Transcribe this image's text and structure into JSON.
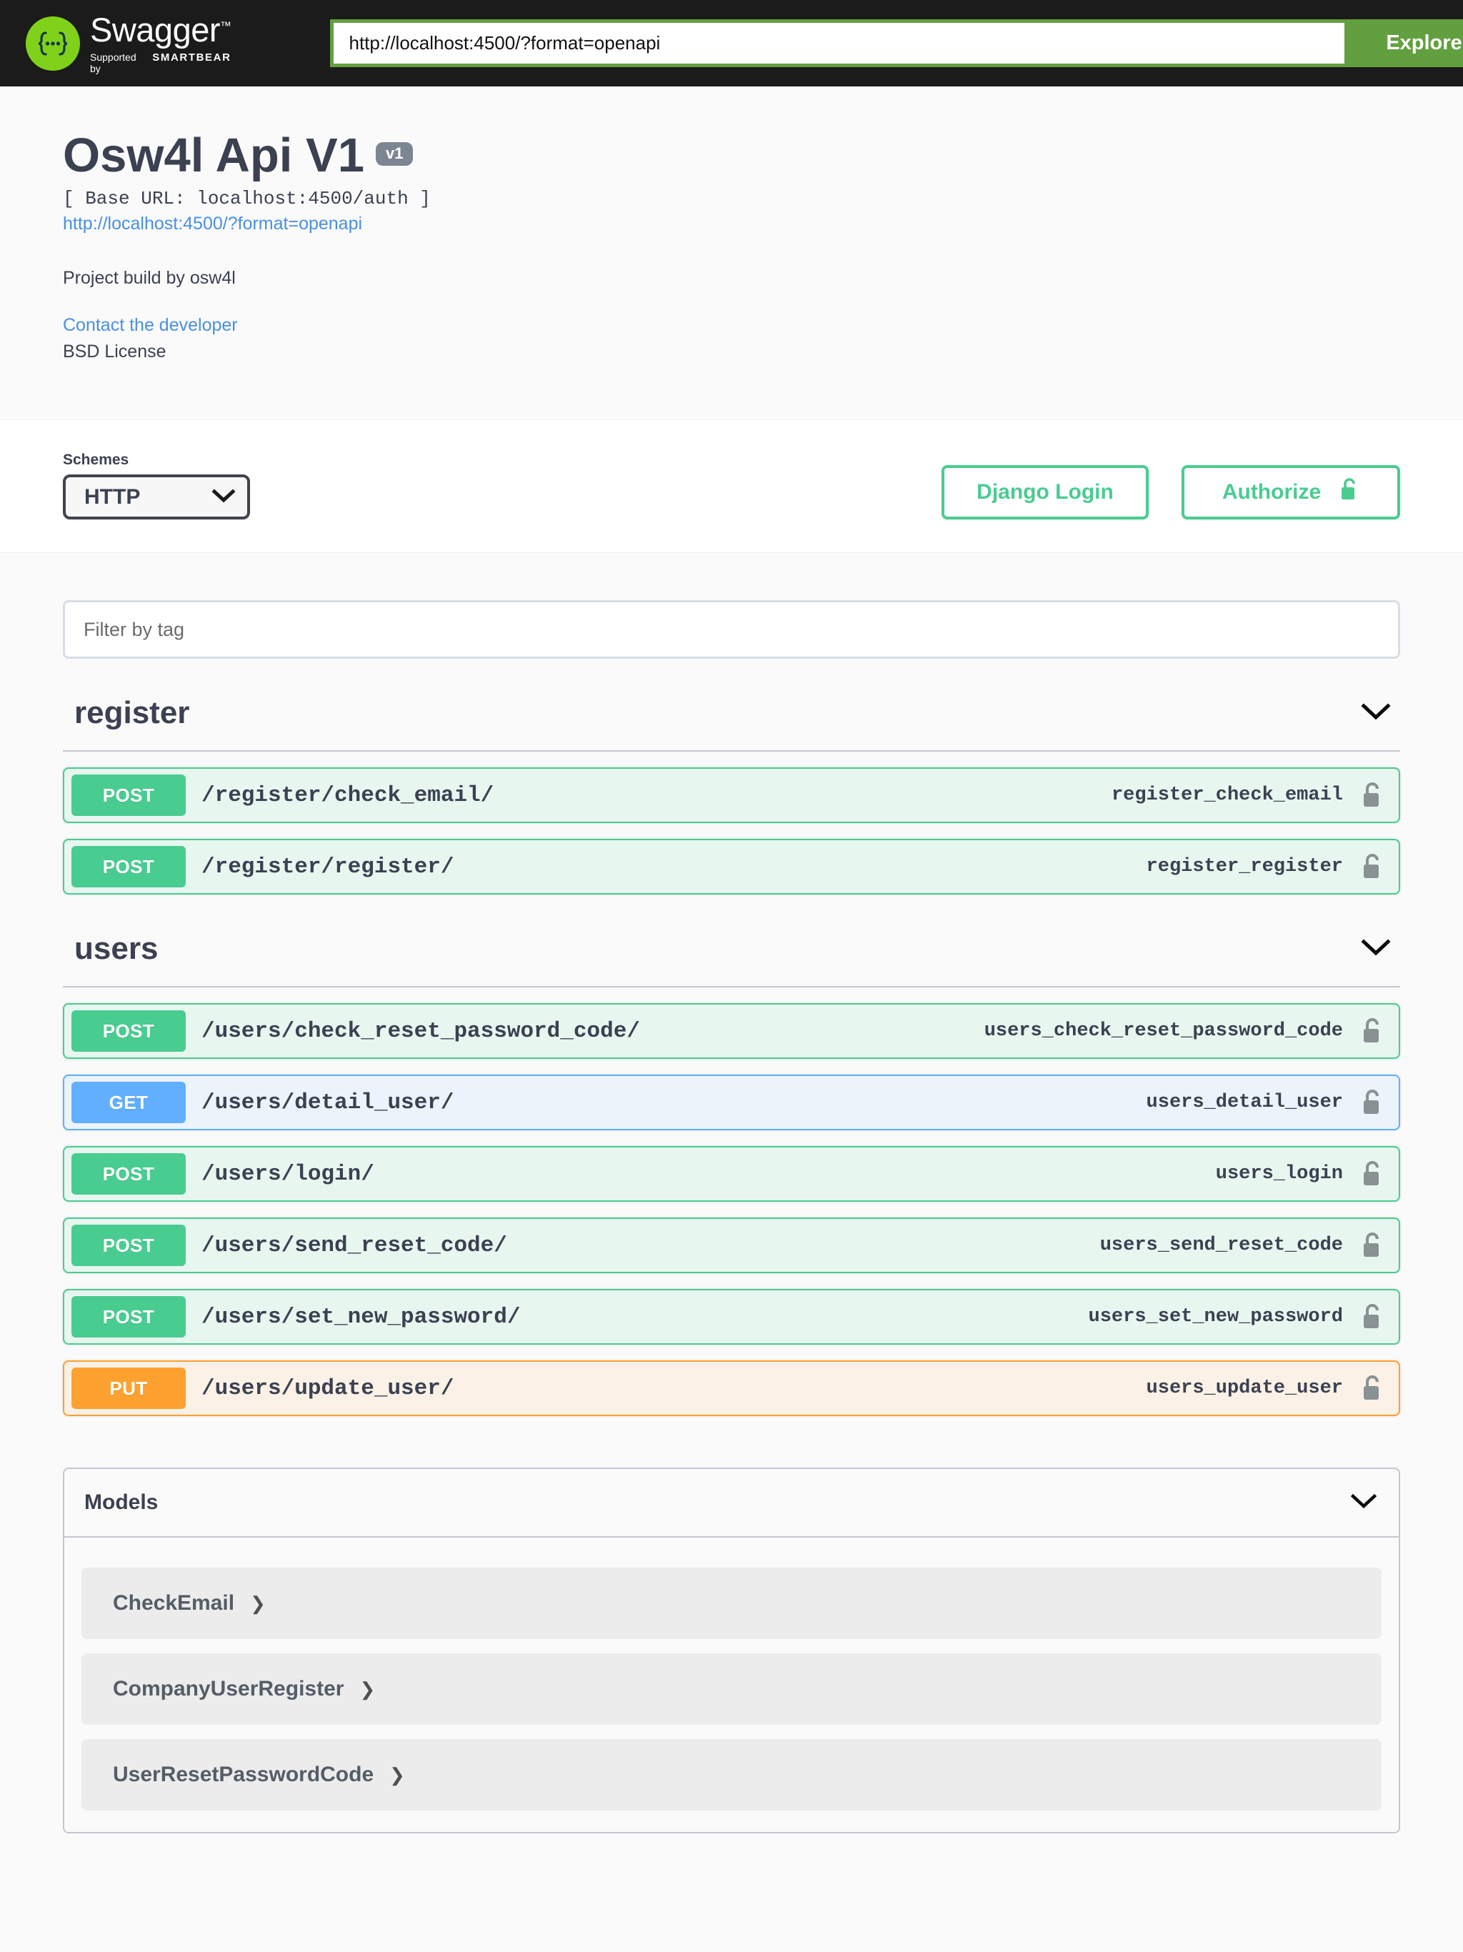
{
  "topbar": {
    "logo_title": "Swagger",
    "logo_tm": "™",
    "logo_supported_prefix": "Supported by",
    "logo_brand": "SMARTBEAR",
    "url_value": "http://localhost:4500/?format=openapi",
    "url_placeholder": "http://localhost:4500/?format=openapi",
    "explore_label": "Explore"
  },
  "info": {
    "title": "Osw4l Api V1",
    "version_badge": "v1",
    "base_url": "[ Base URL: localhost:4500/auth ]",
    "spec_link": "http://localhost:4500/?format=openapi",
    "description": "Project build by osw4l",
    "contact_link": "Contact the developer",
    "license": "BSD License"
  },
  "schemes": {
    "label": "Schemes",
    "selected": "HTTP",
    "options": [
      "HTTP"
    ],
    "django_login_label": "Django Login",
    "authorize_label": "Authorize"
  },
  "filter": {
    "placeholder": "Filter by tag",
    "value": ""
  },
  "tags": [
    {
      "name": "register",
      "operations": [
        {
          "method": "POST",
          "path": "/register/check_email/",
          "operation_id": "register_check_email",
          "locked": true
        },
        {
          "method": "POST",
          "path": "/register/register/",
          "operation_id": "register_register",
          "locked": true
        }
      ]
    },
    {
      "name": "users",
      "operations": [
        {
          "method": "POST",
          "path": "/users/check_reset_password_code/",
          "operation_id": "users_check_reset_password_code",
          "locked": true
        },
        {
          "method": "GET",
          "path": "/users/detail_user/",
          "operation_id": "users_detail_user",
          "locked": true
        },
        {
          "method": "POST",
          "path": "/users/login/",
          "operation_id": "users_login",
          "locked": true
        },
        {
          "method": "POST",
          "path": "/users/send_reset_code/",
          "operation_id": "users_send_reset_code",
          "locked": true
        },
        {
          "method": "POST",
          "path": "/users/set_new_password/",
          "operation_id": "users_set_new_password",
          "locked": true
        },
        {
          "method": "PUT",
          "path": "/users/update_user/",
          "operation_id": "users_update_user",
          "locked": true
        }
      ]
    }
  ],
  "models": {
    "title": "Models",
    "items": [
      {
        "name": "CheckEmail"
      },
      {
        "name": "CompanyUserRegister"
      },
      {
        "name": "UserResetPasswordCode"
      }
    ]
  },
  "colors": {
    "topbar_bg": "#1b1b1b",
    "explore_green": "#62a03f",
    "logo_green": "#7fd219",
    "post_green": "#49cc90",
    "get_blue": "#61affe",
    "put_orange": "#fca130",
    "text_dark": "#3b4151",
    "link_blue": "#4990e2",
    "badge_grey": "#7d8492",
    "lock_grey": "#899193"
  }
}
